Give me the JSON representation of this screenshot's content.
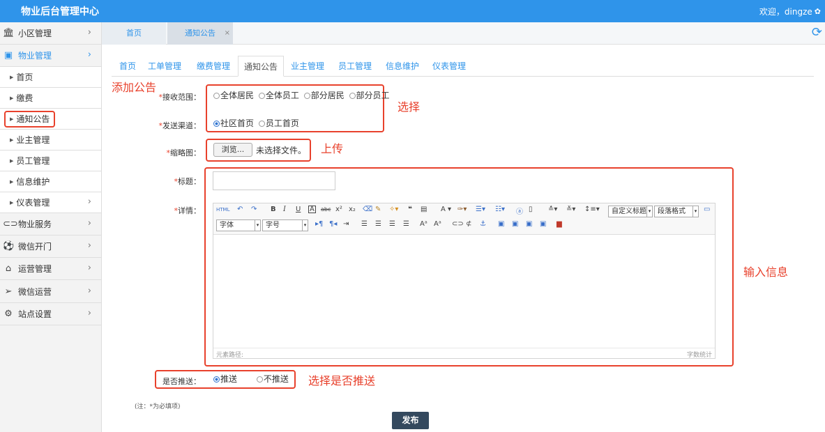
{
  "header": {
    "title": "物业后台管理中心",
    "welcome": "欢迎，dingze"
  },
  "sidebar": {
    "items": [
      {
        "label": "小区管理"
      },
      {
        "label": "物业管理"
      },
      {
        "label": "物业服务"
      },
      {
        "label": "微信开门"
      },
      {
        "label": "运营管理"
      },
      {
        "label": "微信运营"
      },
      {
        "label": "站点设置"
      }
    ],
    "subitems": [
      {
        "label": "首页"
      },
      {
        "label": "缴费"
      },
      {
        "label": "通知公告"
      },
      {
        "label": "业主管理"
      },
      {
        "label": "员工管理"
      },
      {
        "label": "信息维护"
      },
      {
        "label": "仪表管理"
      }
    ]
  },
  "tabs": {
    "home": "首页",
    "notice": "通知公告",
    "close": "×"
  },
  "nav": {
    "items": [
      "首页",
      "工单管理",
      "缴费管理",
      "通知公告",
      "业主管理",
      "员工管理",
      "信息维护",
      "仪表管理"
    ]
  },
  "annotations": {
    "add_notice": "添加公告",
    "select": "选择",
    "upload": "上传",
    "input_info": "输入信息",
    "select_push": "选择是否推送"
  },
  "form": {
    "receive_label": "接收范围：",
    "receive_options": [
      "全体居民",
      "全体员工",
      "部分居民",
      "部分员工"
    ],
    "channel_label": "发送渠道：",
    "channel_options": [
      "社区首页",
      "员工首页"
    ],
    "thumb_label": "缩略图：",
    "browse": "浏览...",
    "no_file": "未选择文件。",
    "title_label": "标题：",
    "detail_label": "详情：",
    "push_label": "是否推送：",
    "push_options": [
      "推送",
      "不推送"
    ],
    "required_mark": "*",
    "note": "(注：*为必填项)",
    "submit": "发布"
  },
  "editor": {
    "font": "字体",
    "size": "字号",
    "custom_title": "自定义标题",
    "paragraph": "段落格式",
    "path": "元素路径:",
    "count": "字数统计"
  }
}
